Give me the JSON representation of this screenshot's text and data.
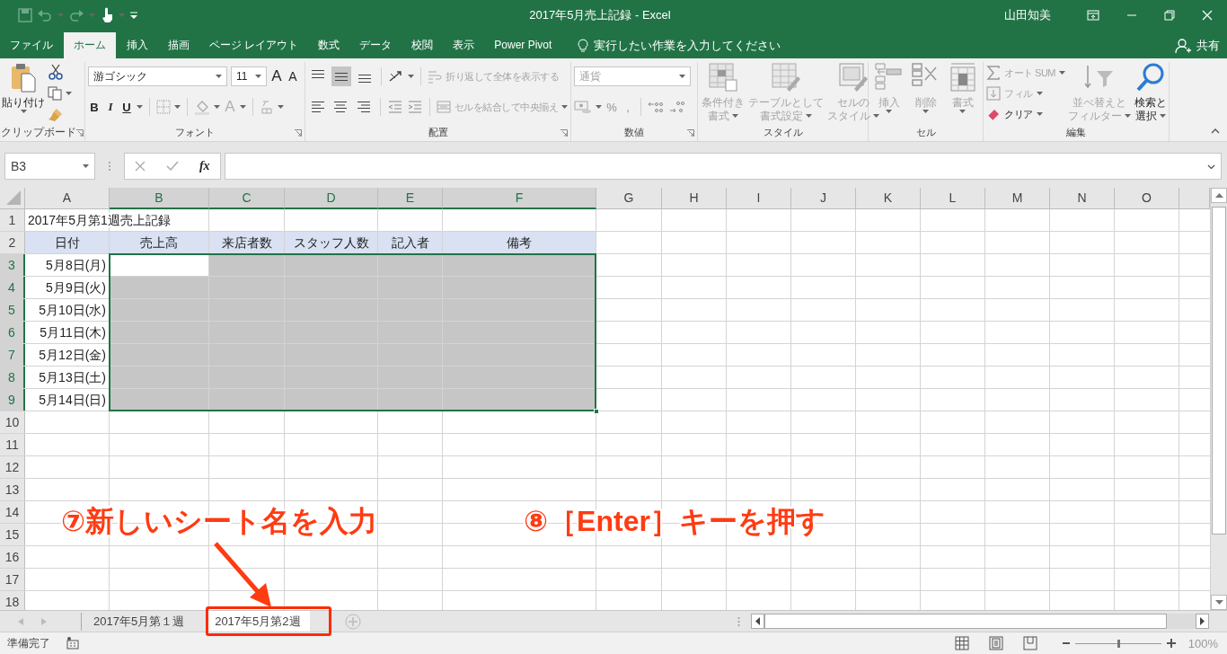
{
  "title_bar": {
    "title": "2017年5月売上記録  -  Excel",
    "user": "山田知美"
  },
  "ribbon_tabs": [
    {
      "label": "ファイル",
      "selected": false
    },
    {
      "label": "ホーム",
      "selected": true
    },
    {
      "label": "挿入",
      "selected": false
    },
    {
      "label": "描画",
      "selected": false
    },
    {
      "label": "ページ レイアウト",
      "selected": false
    },
    {
      "label": "数式",
      "selected": false
    },
    {
      "label": "データ",
      "selected": false
    },
    {
      "label": "校閲",
      "selected": false
    },
    {
      "label": "表示",
      "selected": false
    },
    {
      "label": "Power Pivot",
      "selected": false
    }
  ],
  "tell_me": "実行したい作業を入力してください",
  "share": "共有",
  "ribbon": {
    "clipboard": {
      "label": "クリップボード",
      "paste": "貼り付け"
    },
    "font": {
      "label": "フォント",
      "font_name": "游ゴシック",
      "font_size": "11",
      "grow": "A",
      "shrink": "A",
      "bold": "B",
      "italic": "I",
      "underline": "U",
      "font_color": {
        "text": "A",
        "disabled": true
      }
    },
    "alignment": {
      "label": "配置",
      "vertical": [
        {
          "selected": false
        },
        {
          "selected": true
        },
        {
          "selected": false
        }
      ],
      "horizontal": [
        {
          "selected": false
        },
        {
          "selected": false
        },
        {
          "selected": false
        }
      ],
      "wrap_text": {
        "label": "折り返して全体を表示する",
        "disabled": true
      },
      "merge": {
        "label": "セルを結合して中央揃え",
        "disabled": true
      }
    },
    "number": {
      "label": "数値",
      "format": {
        "value": "通貨",
        "disabled": true
      },
      "percent": "%",
      "comma": ","
    },
    "styles": {
      "label": "スタイル",
      "buttons": [
        {
          "lines": [
            "条件付き",
            "書式"
          ],
          "disabled": true
        },
        {
          "lines": [
            "テーブルとして",
            "書式設定"
          ],
          "disabled": true
        },
        {
          "lines": [
            "セルの",
            "スタイル"
          ],
          "disabled": true
        }
      ]
    },
    "cells": {
      "label": "セル",
      "buttons": [
        {
          "label": "挿入",
          "disabled": true
        },
        {
          "label": "削除",
          "disabled": true
        },
        {
          "label": "書式",
          "disabled": true
        }
      ]
    },
    "editing": {
      "label": "編集",
      "autosum": {
        "label": "オート SUM",
        "disabled": true
      },
      "fill": {
        "label": "フィル",
        "disabled": true
      },
      "clear": {
        "label": "クリア",
        "disabled": false
      },
      "sort": {
        "lines": [
          "並べ替えと",
          "フィルター"
        ],
        "disabled": true
      },
      "find": {
        "lines": [
          "検索と",
          "選択"
        ],
        "disabled": false
      }
    }
  },
  "formula_bar": {
    "name_box": "B3",
    "fx": "fx"
  },
  "sheet": {
    "columns": [
      {
        "label": "A",
        "selected": false
      },
      {
        "label": "B",
        "selected": true
      },
      {
        "label": "C",
        "selected": true
      },
      {
        "label": "D",
        "selected": true
      },
      {
        "label": "E",
        "selected": true
      },
      {
        "label": "F",
        "selected": true
      },
      {
        "label": "G",
        "selected": false
      },
      {
        "label": "H",
        "selected": false
      },
      {
        "label": "I",
        "selected": false
      },
      {
        "label": "J",
        "selected": false
      },
      {
        "label": "K",
        "selected": false
      },
      {
        "label": "L",
        "selected": false
      },
      {
        "label": "M",
        "selected": false
      },
      {
        "label": "N",
        "selected": false
      },
      {
        "label": "O",
        "selected": false
      }
    ],
    "rows": [
      {
        "number": "1",
        "kind": "title",
        "selected": false,
        "cells": [
          "2017年5月第1週売上記録"
        ]
      },
      {
        "number": "2",
        "kind": "header",
        "selected": false,
        "cells": [
          "日付",
          "売上高",
          "来店者数",
          "スタッフ人数",
          "記入者",
          "備考"
        ]
      },
      {
        "number": "3",
        "kind": "data",
        "selected": true,
        "cells": [
          "5月8日(月)"
        ]
      },
      {
        "number": "4",
        "kind": "data",
        "selected": true,
        "cells": [
          "5月9日(火)"
        ]
      },
      {
        "number": "5",
        "kind": "data",
        "selected": true,
        "cells": [
          "5月10日(水)"
        ]
      },
      {
        "number": "6",
        "kind": "data",
        "selected": true,
        "cells": [
          "5月11日(木)"
        ]
      },
      {
        "number": "7",
        "kind": "data",
        "selected": true,
        "cells": [
          "5月12日(金)"
        ]
      },
      {
        "number": "8",
        "kind": "data",
        "selected": true,
        "cells": [
          "5月13日(土)"
        ]
      },
      {
        "number": "9",
        "kind": "data",
        "selected": true,
        "cells": [
          "5月14日(日)"
        ]
      },
      {
        "number": "10",
        "kind": "data",
        "selected": false,
        "cells": []
      },
      {
        "number": "11",
        "kind": "data",
        "selected": false,
        "cells": []
      },
      {
        "number": "12",
        "kind": "data",
        "selected": false,
        "cells": []
      },
      {
        "number": "13",
        "kind": "data",
        "selected": false,
        "cells": []
      },
      {
        "number": "14",
        "kind": "data",
        "selected": false,
        "cells": []
      },
      {
        "number": "15",
        "kind": "data",
        "selected": false,
        "cells": []
      },
      {
        "number": "16",
        "kind": "data",
        "selected": false,
        "cells": []
      },
      {
        "number": "17",
        "kind": "data",
        "selected": false,
        "cells": []
      },
      {
        "number": "18",
        "kind": "data",
        "selected": false,
        "cells": []
      }
    ]
  },
  "sheet_tabs": [
    {
      "label": "2017年5月第１週",
      "selected": false
    },
    {
      "label": "2017年5月第2週",
      "selected": true
    }
  ],
  "status_bar": {
    "status": "準備完了",
    "zoom": {
      "reading": "100%",
      "level": 0.5
    }
  },
  "annotations": [
    {
      "text": "⑦新しいシート名を入力"
    },
    {
      "text": "⑧［Enter］キーを押す"
    }
  ]
}
